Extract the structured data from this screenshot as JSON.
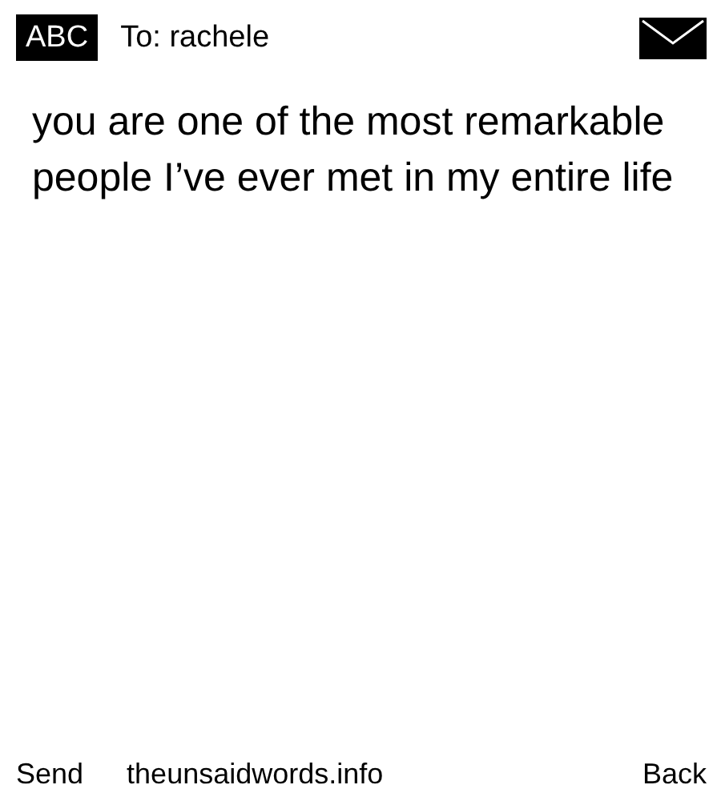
{
  "header": {
    "mode": "ABC",
    "recipient": "To: rachele"
  },
  "message": "you are one of the most remarkable people I’ve ever met in my entire life",
  "softkeys": {
    "left": "Send",
    "center": "theunsaidwords.info",
    "right": "Back"
  }
}
